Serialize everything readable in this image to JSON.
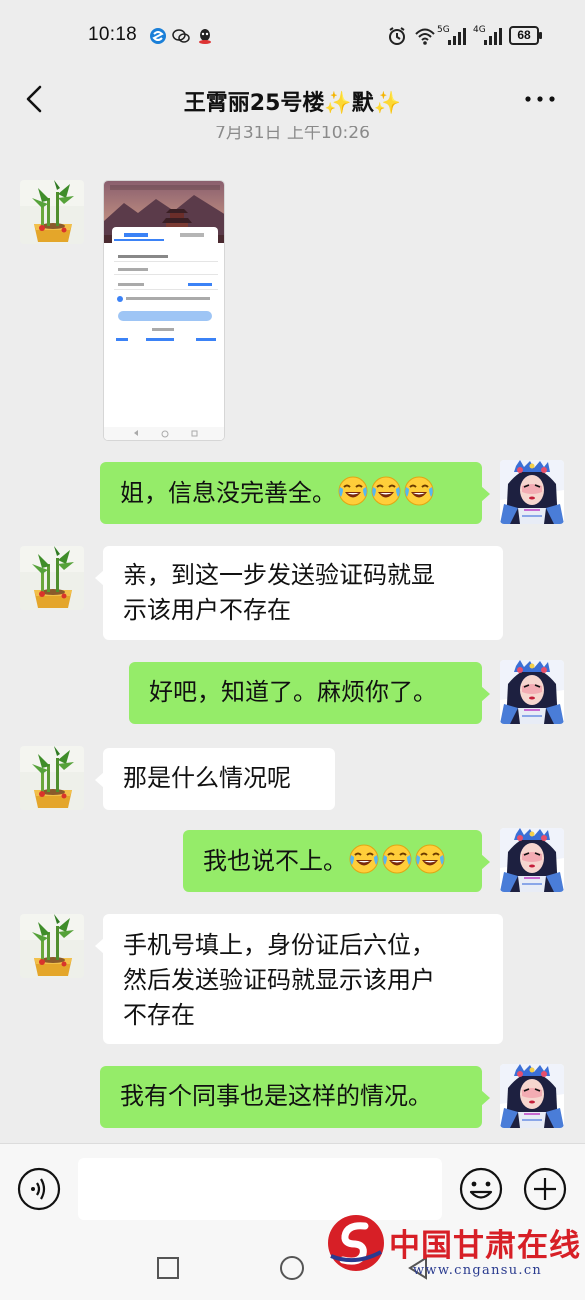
{
  "status_bar": {
    "time": "10:18",
    "net_5g": "5G",
    "net_4g": "4G",
    "battery": "68"
  },
  "header": {
    "title": "王霄丽25号楼✨默✨",
    "back_icon": "chevron-left-icon",
    "more_icon": "more-dots-icon"
  },
  "timestamp": "7月31日 上午10:26",
  "messages": [
    {
      "side": "left",
      "type": "image"
    },
    {
      "side": "right",
      "text": "姐，信息没完善全。",
      "emoji_count": 3
    },
    {
      "side": "left",
      "text_lines": [
        "亲，到这一步发送验证码就显",
        "示该用户不存在"
      ]
    },
    {
      "side": "right",
      "text": "好吧，知道了。麻烦你了。"
    },
    {
      "side": "left",
      "text": "那是什么情况呢"
    },
    {
      "side": "right",
      "text": "我也说不上。",
      "emoji_count": 3
    },
    {
      "side": "left",
      "text_lines": [
        "手机号填上，身份证后六位，",
        "然后发送验证码就显示该用户",
        "不存在"
      ]
    },
    {
      "side": "right",
      "text": "我有个同事也是这样的情况。"
    }
  ],
  "input_bar": {
    "voice_icon": "voice-icon",
    "placeholder": "",
    "emoji_icon": "smiley-icon",
    "plus_icon": "plus-circle-icon"
  },
  "watermark": {
    "name": "中国甘肃在线",
    "url": "www.cngansu.cn"
  },
  "colors": {
    "sent_bubble": "#95ec69",
    "received_bubble": "#ffffff",
    "background": "#ededed",
    "watermark_red": "#d71f26"
  }
}
